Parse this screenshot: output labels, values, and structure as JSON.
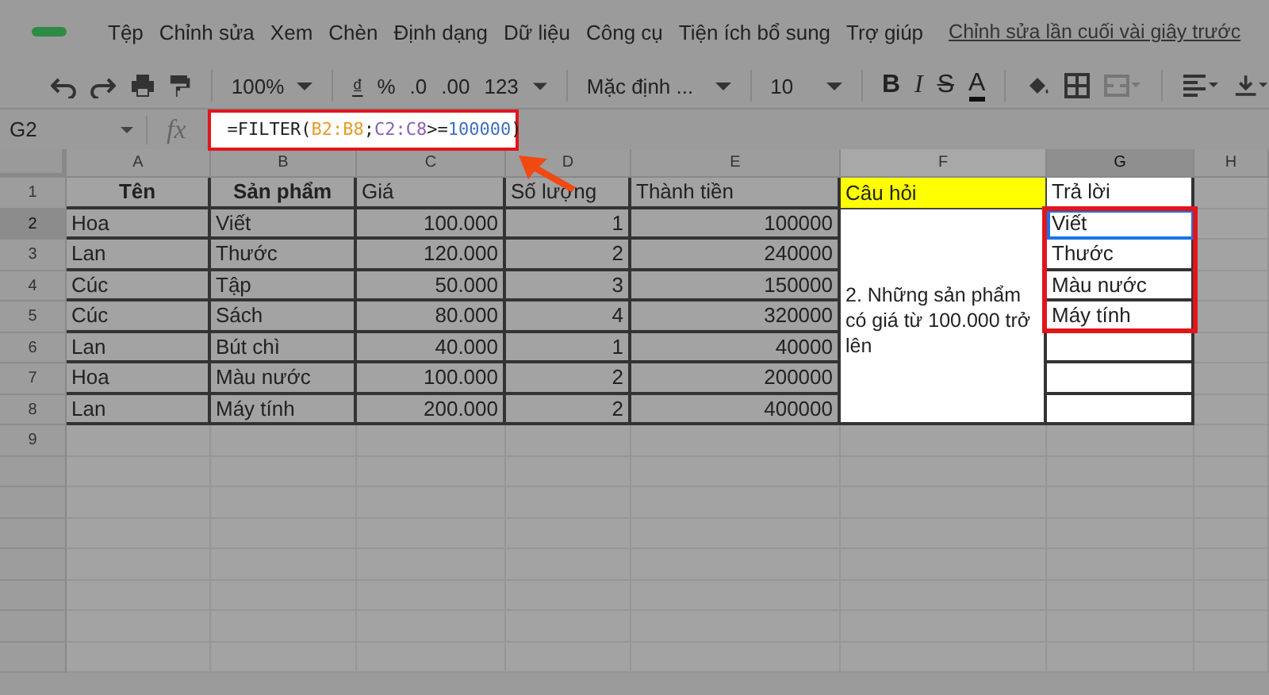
{
  "menu": [
    "Tệp",
    "Chỉnh sửa",
    "Xem",
    "Chèn",
    "Định dạng",
    "Dữ liệu",
    "Công cụ",
    "Tiện ích bổ sung",
    "Trợ giúp"
  ],
  "last_edit": "Chỉnh sửa lần cuối vài giây trước",
  "toolbar": {
    "zoom": "100%",
    "number_formats": [
      "₫",
      "%",
      ".0",
      ".00",
      "123"
    ],
    "font": "Mặc định ...",
    "font_size": "10",
    "text_styles": [
      "B",
      "I",
      "S",
      "A"
    ]
  },
  "name_box": "G2",
  "function_label": "fx",
  "formula": [
    {
      "text": "=FILTER(",
      "color": "#222222"
    },
    {
      "text": "B2:B8",
      "color": "#e69a28"
    },
    {
      "text": ";",
      "color": "#222222"
    },
    {
      "text": "C2:C8",
      "color": "#8a5fb0"
    },
    {
      "text": ">=",
      "color": "#222222"
    },
    {
      "text": "100000",
      "color": "#3f6fc4"
    },
    {
      "text": ")",
      "color": "#222222"
    }
  ],
  "columns": [
    {
      "letter": "A",
      "selected": false
    },
    {
      "letter": "B",
      "selected": false
    },
    {
      "letter": "C",
      "selected": false
    },
    {
      "letter": "D",
      "selected": false
    },
    {
      "letter": "E",
      "selected": false
    },
    {
      "letter": "F",
      "selected": false
    },
    {
      "letter": "G",
      "selected": true
    },
    {
      "letter": "H",
      "selected": false
    }
  ],
  "header_row": {
    "number": "1",
    "selected": false,
    "cells": [
      {
        "text": "Tên",
        "bold": true
      },
      {
        "text": "Sản phẩm",
        "bold": true
      },
      {
        "text": "Giá",
        "bold": false
      },
      {
        "text": "Số lượng",
        "bold": false
      },
      {
        "text": "Thành tiền",
        "bold": false
      }
    ],
    "question_title": "Câu hỏi",
    "answer_title": "Trả lời"
  },
  "data_rows": [
    {
      "number": "2",
      "selected": true,
      "cells": [
        "Hoa",
        "Viết",
        "100.000",
        "1",
        "100000"
      ]
    },
    {
      "number": "3",
      "selected": false,
      "cells": [
        "Lan",
        "Thước",
        "120.000",
        "2",
        "240000"
      ]
    },
    {
      "number": "4",
      "selected": false,
      "cells": [
        "Cúc",
        "Tập",
        "50.000",
        "3",
        "150000"
      ]
    },
    {
      "number": "5",
      "selected": false,
      "cells": [
        "Cúc",
        "Sách",
        "80.000",
        "4",
        "320000"
      ]
    },
    {
      "number": "6",
      "selected": false,
      "cells": [
        "Lan",
        "Bút chì",
        "40.000",
        "1",
        "40000"
      ]
    },
    {
      "number": "7",
      "selected": false,
      "cells": [
        "Hoa",
        "Màu nước",
        "100.000",
        "2",
        "200000"
      ]
    },
    {
      "number": "8",
      "selected": false,
      "cells": [
        "Lan",
        "Máy tính",
        "200.000",
        "2",
        "400000"
      ]
    }
  ],
  "question": "2. Những sản phẩm có giá từ 100.000 trở lên",
  "answers": [
    {
      "text": "Viết",
      "selected": true
    },
    {
      "text": "Thước",
      "selected": false
    },
    {
      "text": "Màu nước",
      "selected": false
    },
    {
      "text": "Máy tính",
      "selected": false
    }
  ],
  "empty_rows": [
    "9"
  ]
}
